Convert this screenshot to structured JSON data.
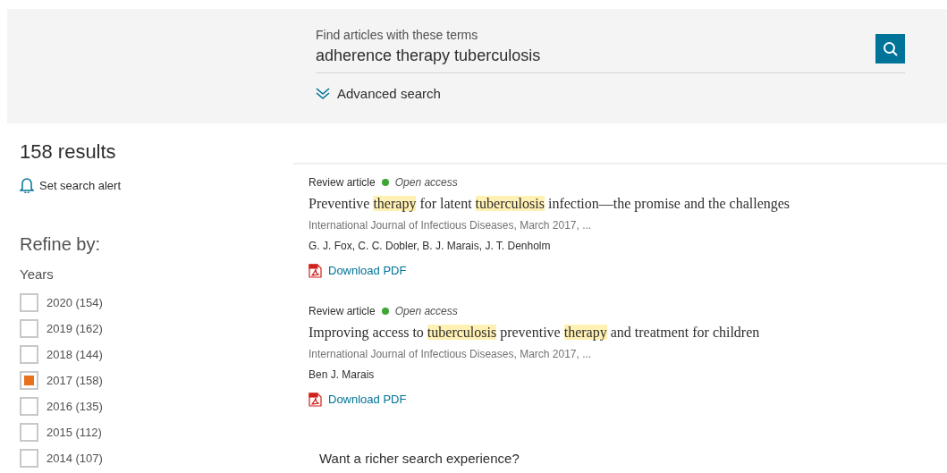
{
  "search": {
    "label": "Find articles with these terms",
    "value": "adherence therapy tuberculosis",
    "advanced_link": "Advanced search"
  },
  "results_count": "158 results",
  "alert_link": "Set search alert",
  "refine": {
    "title": "Refine by:",
    "section": "Years",
    "options": [
      {
        "label": "2020 (154)",
        "checked": false
      },
      {
        "label": "2019 (162)",
        "checked": false
      },
      {
        "label": "2018 (144)",
        "checked": false
      },
      {
        "label": "2017 (158)",
        "checked": true
      },
      {
        "label": "2016 (135)",
        "checked": false
      },
      {
        "label": "2015 (112)",
        "checked": false
      },
      {
        "label": "2014 (107)",
        "checked": false
      }
    ]
  },
  "results": [
    {
      "type": "Review article",
      "access": "Open access",
      "title": [
        {
          "text": "Preventive ",
          "highlighted": false
        },
        {
          "text": "therapy",
          "highlighted": true
        },
        {
          "text": " for latent ",
          "highlighted": false
        },
        {
          "text": "tuberculosis",
          "highlighted": true
        },
        {
          "text": " infection—the promise and the challenges",
          "highlighted": false
        }
      ],
      "source": "International Journal of Infectious Diseases, March 2017, ...",
      "authors": "G. J. Fox, C. C. Dobler, B. J. Marais, J. T. Denholm",
      "download": "Download PDF"
    },
    {
      "type": "Review article",
      "access": "Open access",
      "title": [
        {
          "text": "Improving access to ",
          "highlighted": false
        },
        {
          "text": "tuberculosis",
          "highlighted": true
        },
        {
          "text": " preventive ",
          "highlighted": false
        },
        {
          "text": "therapy",
          "highlighted": true
        },
        {
          "text": " and treatment for children",
          "highlighted": false
        }
      ],
      "source": "International Journal of Infectious Diseases, March 2017, ...",
      "authors": "Ben J. Marais",
      "download": "Download PDF"
    }
  ],
  "promo": "Want a richer search experience?"
}
